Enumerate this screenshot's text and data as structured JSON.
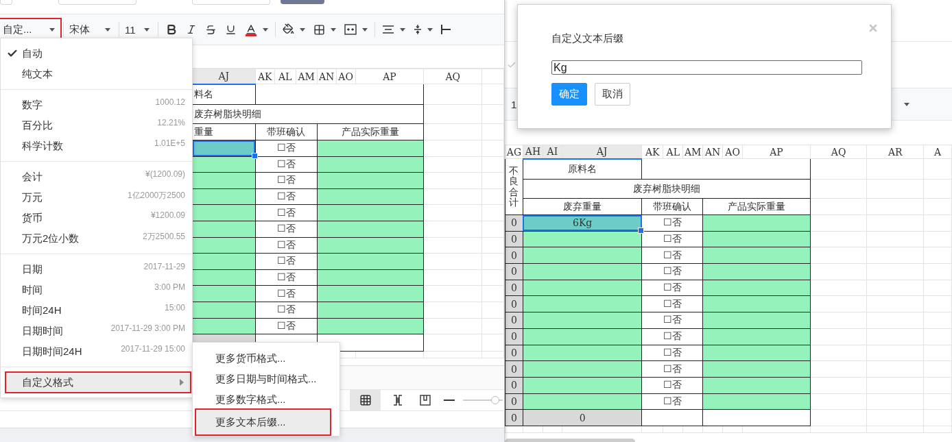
{
  "left": {
    "top_buttons": [
      {
        "kind": "plain"
      },
      {
        "kind": "plain"
      },
      {
        "kind": "plain"
      },
      {
        "kind": "primary"
      }
    ],
    "toolbar": [
      {
        "kind": "select",
        "text": "自定...",
        "annotated": true
      },
      {
        "kind": "divider"
      },
      {
        "kind": "select",
        "text": "宋体",
        "annotated": false
      },
      {
        "kind": "divider"
      },
      {
        "kind": "select",
        "text": "11",
        "annotated": false
      },
      {
        "kind": "divider"
      },
      {
        "kind": "bold",
        "dropdown": false
      },
      {
        "kind": "italic",
        "dropdown": false
      },
      {
        "kind": "strike",
        "dropdown": false
      },
      {
        "kind": "underline",
        "dropdown": false
      },
      {
        "kind": "font_color",
        "dropdown": true
      },
      {
        "kind": "divider"
      },
      {
        "kind": "fill",
        "dropdown": true
      },
      {
        "kind": "borders",
        "dropdown": true
      },
      {
        "kind": "merge",
        "dropdown": true
      },
      {
        "kind": "divider"
      },
      {
        "kind": "align",
        "dropdown": true
      },
      {
        "kind": "valign",
        "dropdown": true
      },
      {
        "kind": "indent",
        "dropdown": false
      }
    ],
    "sheet": {
      "columns": [
        {
          "label": "AJ",
          "selected": true
        },
        {
          "label": "AK",
          "selected": false
        },
        {
          "label": "AL",
          "selected": false
        },
        {
          "label": "AM",
          "selected": false
        },
        {
          "label": "AN",
          "selected": false
        },
        {
          "label": "AO",
          "selected": false
        },
        {
          "label": "AP",
          "selected": false
        },
        {
          "label": "AQ",
          "selected": false
        }
      ],
      "rows": [
        [
          {
            "kind": "label",
            "text": "料名"
          },
          {
            "kind": "blank",
            "colspan": 6
          }
        ],
        [
          {
            "kind": "label",
            "text": "废弃树脂块明细",
            "colspan": 7
          }
        ],
        [
          {
            "kind": "label",
            "text": "重量"
          },
          {
            "kind": "label",
            "text": "带班确认",
            "colspan": 3
          },
          {
            "kind": "label",
            "text": "产品实际重量",
            "colspan": 3
          }
        ],
        [
          {
            "kind": "selected"
          },
          {
            "kind": "check",
            "text": "☐否",
            "colspan": 3
          },
          {
            "kind": "green",
            "colspan": 3
          }
        ],
        [
          {
            "kind": "green"
          },
          {
            "kind": "check",
            "text": "☐否",
            "colspan": 3
          },
          {
            "kind": "green",
            "colspan": 3
          }
        ],
        [
          {
            "kind": "green"
          },
          {
            "kind": "check",
            "text": "☐否",
            "colspan": 3
          },
          {
            "kind": "green",
            "colspan": 3
          }
        ],
        [
          {
            "kind": "green"
          },
          {
            "kind": "check",
            "text": "☐否",
            "colspan": 3
          },
          {
            "kind": "green",
            "colspan": 3
          }
        ],
        [
          {
            "kind": "green"
          },
          {
            "kind": "check",
            "text": "☐否",
            "colspan": 3
          },
          {
            "kind": "green",
            "colspan": 3
          }
        ],
        [
          {
            "kind": "green"
          },
          {
            "kind": "check",
            "text": "☐否",
            "colspan": 3
          },
          {
            "kind": "green",
            "colspan": 3
          }
        ],
        [
          {
            "kind": "green"
          },
          {
            "kind": "check",
            "text": "☐否",
            "colspan": 3
          },
          {
            "kind": "green",
            "colspan": 3
          }
        ],
        [
          {
            "kind": "green"
          },
          {
            "kind": "check",
            "text": "☐否",
            "colspan": 3
          },
          {
            "kind": "green",
            "colspan": 3
          }
        ],
        [
          {
            "kind": "green"
          },
          {
            "kind": "check",
            "text": "☐否",
            "colspan": 3
          },
          {
            "kind": "green",
            "colspan": 3
          }
        ],
        [
          {
            "kind": "green"
          },
          {
            "kind": "check",
            "text": "☐否",
            "colspan": 3
          },
          {
            "kind": "green",
            "colspan": 3
          }
        ],
        [
          {
            "kind": "green"
          },
          {
            "kind": "check",
            "text": "☐否",
            "colspan": 3
          },
          {
            "kind": "green",
            "colspan": 3
          }
        ],
        [
          {
            "kind": "green"
          },
          {
            "kind": "check",
            "text": "☐否",
            "colspan": 3
          },
          {
            "kind": "green",
            "colspan": 3
          }
        ],
        [
          {
            "kind": "gray"
          },
          {
            "kind": "blank",
            "colspan": 3
          },
          {
            "kind": "blank",
            "colspan": 3
          }
        ]
      ]
    },
    "status_bar": [
      {
        "kind": "grid",
        "selected": true
      },
      {
        "kind": "page_break",
        "selected": false
      },
      {
        "kind": "page",
        "selected": false
      },
      {
        "kind": "zoom_out",
        "selected": false
      }
    ],
    "zoom_slider": {
      "level": 0.9
    },
    "format_menu": {
      "groups": [
        {
          "items": [
            {
              "kind": "option",
              "label": "自动",
              "checked": true,
              "selected": false,
              "annotated": false
            },
            {
              "kind": "option",
              "label": "纯文本",
              "checked": false,
              "selected": false,
              "annotated": false
            }
          ]
        },
        {
          "items": [
            {
              "kind": "option",
              "label": "数字",
              "example": "1000.12",
              "checked": false,
              "selected": false,
              "annotated": false
            },
            {
              "kind": "option",
              "label": "百分比",
              "example": "12.21%",
              "checked": false,
              "selected": false,
              "annotated": false
            },
            {
              "kind": "option",
              "label": "科学计数",
              "example": "1.01E+5",
              "checked": false,
              "selected": false,
              "annotated": false
            }
          ]
        },
        {
          "items": [
            {
              "kind": "option",
              "label": "会计",
              "example": "¥(1200.09)",
              "checked": false,
              "selected": false,
              "annotated": false
            },
            {
              "kind": "option",
              "label": "万元",
              "example": "1亿2000万2500",
              "checked": false,
              "selected": false,
              "annotated": false
            },
            {
              "kind": "option",
              "label": "货币",
              "example": "¥1200.09",
              "checked": false,
              "selected": false,
              "annotated": false
            },
            {
              "kind": "option",
              "label": "万元2位小数",
              "example": "2万2500.55",
              "checked": false,
              "selected": false,
              "annotated": false
            }
          ]
        },
        {
          "items": [
            {
              "kind": "option",
              "label": "日期",
              "example": "2017-11-29",
              "checked": false,
              "selected": false,
              "annotated": false
            },
            {
              "kind": "option",
              "label": "时间",
              "example": "3:00 PM",
              "checked": false,
              "selected": false,
              "annotated": false
            },
            {
              "kind": "option",
              "label": "时间24H",
              "example": "15:00",
              "checked": false,
              "selected": false,
              "annotated": false
            },
            {
              "kind": "option",
              "label": "日期时间",
              "example": "2017-11-29 3:00 PM",
              "checked": false,
              "selected": false,
              "annotated": false
            },
            {
              "kind": "option",
              "label": "日期时间24H",
              "example": "2017-11-29 15:00",
              "checked": false,
              "selected": false,
              "annotated": false
            }
          ]
        },
        {
          "items": [
            {
              "kind": "submenu",
              "label": "自定义格式",
              "checked": false,
              "selected": true,
              "annotated": true
            }
          ]
        }
      ]
    },
    "submenu": {
      "items": [
        {
          "label": "更多货币格式...",
          "selected": false,
          "annotated": false
        },
        {
          "label": "更多日期与时间格式...",
          "selected": false,
          "annotated": false
        },
        {
          "label": "更多数字格式...",
          "selected": false,
          "annotated": false
        },
        {
          "label": "更多文本后缀...",
          "selected": true,
          "annotated": true
        }
      ]
    }
  },
  "right": {
    "toolbar_fragment": {
      "text": "1"
    },
    "sheet": {
      "columns": [
        {
          "label": "AG",
          "selected": false
        },
        {
          "label": "AH",
          "selected": true
        },
        {
          "label": "AI",
          "selected": true
        },
        {
          "label": "AJ",
          "selected": true
        },
        {
          "label": "AK",
          "selected": false
        },
        {
          "label": "AL",
          "selected": false
        },
        {
          "label": "AM",
          "selected": false
        },
        {
          "label": "AN",
          "selected": false
        },
        {
          "label": "AO",
          "selected": false
        },
        {
          "label": "AP",
          "selected": false
        },
        {
          "label": "AQ",
          "selected": false
        },
        {
          "label": "AR",
          "selected": false
        },
        {
          "label": "A",
          "selected": false
        }
      ],
      "rows": [
        [
          {
            "kind": "vlabel",
            "text": "不良合计",
            "rowspan": 3
          },
          {
            "kind": "label",
            "text": "原料名",
            "colspan": 3
          },
          {
            "kind": "blank",
            "colspan": 6
          }
        ],
        [
          {
            "kind": "label",
            "text": "废弃树脂块明细",
            "colspan": 9
          }
        ],
        [
          {
            "kind": "label",
            "text": "废弃重量",
            "colspan": 3
          },
          {
            "kind": "label",
            "text": "带班确认",
            "colspan": 3
          },
          {
            "kind": "label",
            "text": "产品实际重量",
            "colspan": 3
          }
        ],
        [
          {
            "kind": "gray",
            "text": "0"
          },
          {
            "kind": "selected",
            "text": "6Kg",
            "colspan": 3
          },
          {
            "kind": "check",
            "text": "☐否",
            "colspan": 3
          },
          {
            "kind": "green",
            "colspan": 3
          }
        ],
        [
          {
            "kind": "gray",
            "text": "0"
          },
          {
            "kind": "green",
            "colspan": 3
          },
          {
            "kind": "check",
            "text": "☐否",
            "colspan": 3
          },
          {
            "kind": "green",
            "colspan": 3
          }
        ],
        [
          {
            "kind": "gray",
            "text": "0"
          },
          {
            "kind": "green",
            "colspan": 3
          },
          {
            "kind": "check",
            "text": "☐否",
            "colspan": 3
          },
          {
            "kind": "green",
            "colspan": 3
          }
        ],
        [
          {
            "kind": "gray",
            "text": "0"
          },
          {
            "kind": "green",
            "colspan": 3
          },
          {
            "kind": "check",
            "text": "☐否",
            "colspan": 3
          },
          {
            "kind": "green",
            "colspan": 3
          }
        ],
        [
          {
            "kind": "gray",
            "text": "0"
          },
          {
            "kind": "green",
            "colspan": 3
          },
          {
            "kind": "check",
            "text": "☐否",
            "colspan": 3
          },
          {
            "kind": "green",
            "colspan": 3
          }
        ],
        [
          {
            "kind": "gray",
            "text": "0"
          },
          {
            "kind": "green",
            "colspan": 3
          },
          {
            "kind": "check",
            "text": "☐否",
            "colspan": 3
          },
          {
            "kind": "green",
            "colspan": 3
          }
        ],
        [
          {
            "kind": "gray",
            "text": "0"
          },
          {
            "kind": "green",
            "colspan": 3
          },
          {
            "kind": "check",
            "text": "☐否",
            "colspan": 3
          },
          {
            "kind": "green",
            "colspan": 3
          }
        ],
        [
          {
            "kind": "gray",
            "text": "0"
          },
          {
            "kind": "green",
            "colspan": 3
          },
          {
            "kind": "check",
            "text": "☐否",
            "colspan": 3
          },
          {
            "kind": "green",
            "colspan": 3
          }
        ],
        [
          {
            "kind": "gray",
            "text": "0"
          },
          {
            "kind": "green",
            "colspan": 3
          },
          {
            "kind": "check",
            "text": "☐否",
            "colspan": 3
          },
          {
            "kind": "green",
            "colspan": 3
          }
        ],
        [
          {
            "kind": "gray",
            "text": "0"
          },
          {
            "kind": "green",
            "colspan": 3
          },
          {
            "kind": "check",
            "text": "☐否",
            "colspan": 3
          },
          {
            "kind": "green",
            "colspan": 3
          }
        ],
        [
          {
            "kind": "gray",
            "text": "0"
          },
          {
            "kind": "green",
            "colspan": 3
          },
          {
            "kind": "check",
            "text": "☐否",
            "colspan": 3
          },
          {
            "kind": "green",
            "colspan": 3
          }
        ],
        [
          {
            "kind": "gray",
            "text": "0"
          },
          {
            "kind": "green",
            "colspan": 3
          },
          {
            "kind": "check",
            "text": "☐否",
            "colspan": 3
          },
          {
            "kind": "green",
            "colspan": 3
          }
        ],
        [
          {
            "kind": "gray",
            "text": "0"
          },
          {
            "kind": "gray",
            "text": "0",
            "colspan": 3
          },
          {
            "kind": "blank",
            "colspan": 3
          },
          {
            "kind": "blank",
            "colspan": 3
          }
        ]
      ]
    },
    "dialog": {
      "title": "自定义文本后缀",
      "value": "Kg",
      "buttons": [
        {
          "kind": "primary",
          "text": "确定"
        },
        {
          "kind": "default",
          "text": "取消"
        }
      ]
    }
  }
}
